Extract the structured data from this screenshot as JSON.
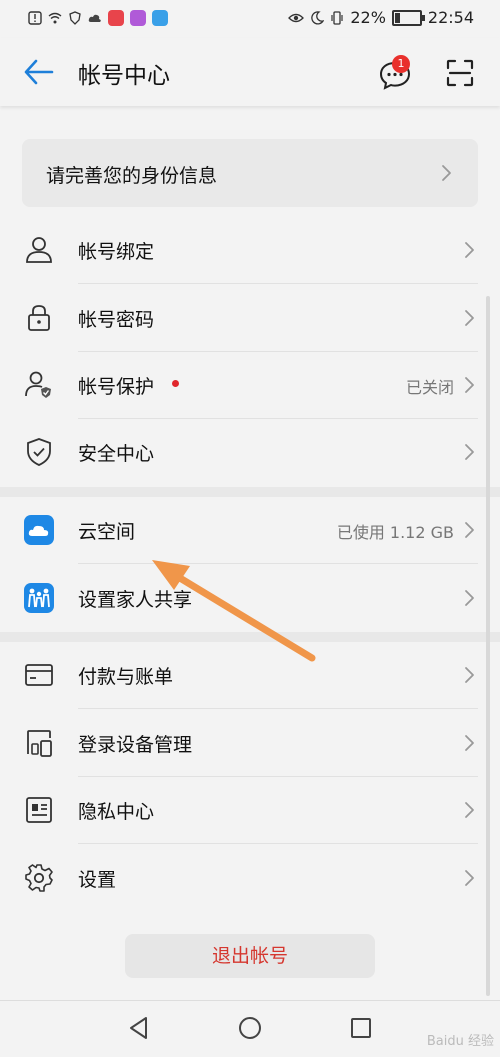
{
  "status_bar": {
    "battery_percent": "22%",
    "battery_level": 0.22,
    "time": "22:54"
  },
  "header": {
    "title": "帐号中心",
    "message_badge": "1",
    "back_icon": "arrow-left-icon",
    "message_icon": "chat-bubble-icon",
    "scan_icon": "scan-frame-icon"
  },
  "identity_card": {
    "label": "请完善您的身份信息"
  },
  "section_account": [
    {
      "label": "帐号绑定",
      "icon": "person-icon",
      "value": ""
    },
    {
      "label": "帐号密码",
      "icon": "lock-icon",
      "value": ""
    },
    {
      "label": "帐号保护",
      "icon": "person-shield-icon",
      "value": "已关闭"
    },
    {
      "label": "安全中心",
      "icon": "shield-check-icon",
      "value": ""
    }
  ],
  "section_cloud": [
    {
      "label": "云空间",
      "icon": "cloud-icon",
      "value": "已使用 1.12 GB"
    },
    {
      "label": "设置家人共享",
      "icon": "family-icon",
      "value": ""
    }
  ],
  "section_other": [
    {
      "label": "付款与账单",
      "icon": "card-icon",
      "value": ""
    },
    {
      "label": "登录设备管理",
      "icon": "devices-icon",
      "value": ""
    },
    {
      "label": "隐私中心",
      "icon": "privacy-icon",
      "value": ""
    },
    {
      "label": "设置",
      "icon": "gear-icon",
      "value": ""
    }
  ],
  "logout_button": "退出帐号",
  "watermark": "Baidu 经验",
  "colors": {
    "accent": "#1e7fd9",
    "danger": "#d5372f",
    "badge": "#e9302c",
    "annotation_arrow": "#f0964a"
  }
}
